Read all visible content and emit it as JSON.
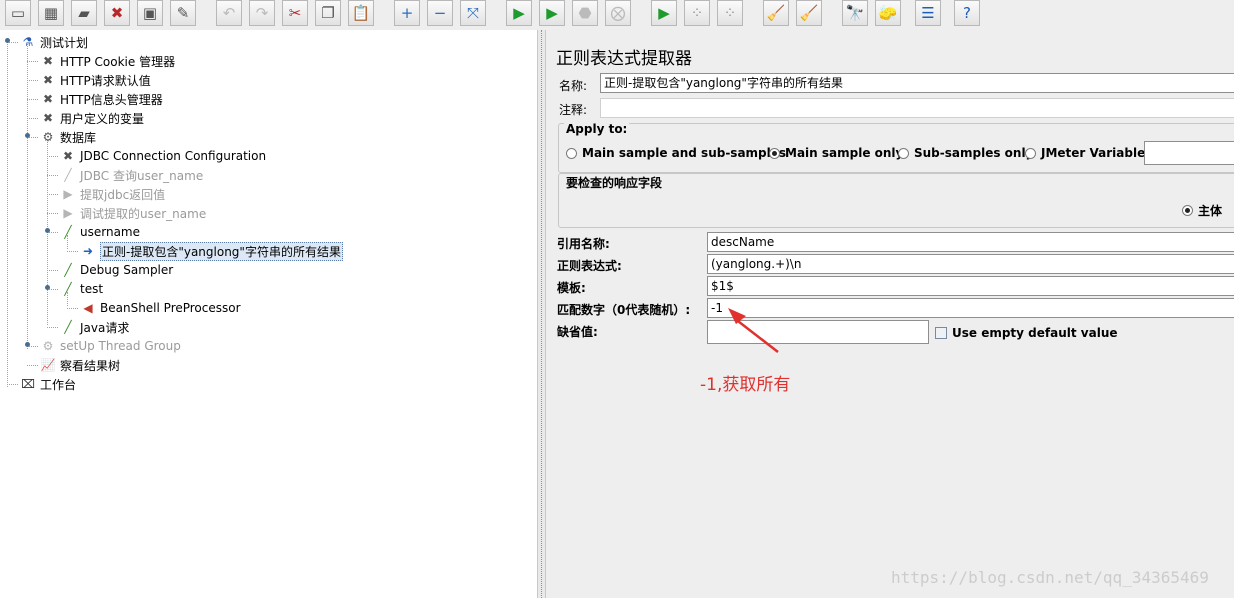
{
  "toolbar": {
    "buttons": [
      {
        "icon": "new-icon",
        "glyph": "▭"
      },
      {
        "icon": "templates-icon",
        "glyph": "▦"
      },
      {
        "icon": "open-icon",
        "glyph": "▰"
      },
      {
        "icon": "close-icon",
        "glyph": "✖"
      },
      {
        "icon": "save-icon",
        "glyph": "▣"
      },
      {
        "icon": "save-as-icon",
        "glyph": "✎"
      },
      {
        "icon": "undo-icon",
        "glyph": "↶"
      },
      {
        "icon": "redo-icon",
        "glyph": "↷"
      },
      {
        "icon": "cut-icon",
        "glyph": "✂"
      },
      {
        "icon": "copy-icon",
        "glyph": "❐"
      },
      {
        "icon": "paste-icon",
        "glyph": "📋"
      },
      {
        "icon": "expand-icon",
        "glyph": "+"
      },
      {
        "icon": "collapse-icon",
        "glyph": "−"
      },
      {
        "icon": "toggle-icon",
        "glyph": "⤧"
      },
      {
        "icon": "start-icon",
        "glyph": "▶"
      },
      {
        "icon": "start-no-pause-icon",
        "glyph": "▶"
      },
      {
        "icon": "stop-icon",
        "glyph": "⬣"
      },
      {
        "icon": "shutdown-icon",
        "glyph": "⨂"
      },
      {
        "icon": "remote-start-icon",
        "glyph": "▶"
      },
      {
        "icon": "remote-stop-icon",
        "glyph": "⁘"
      },
      {
        "icon": "remote-shutdown-icon",
        "glyph": "⁘"
      },
      {
        "icon": "clear-icon",
        "glyph": "🧹"
      },
      {
        "icon": "clear-all-icon",
        "glyph": "🧹"
      },
      {
        "icon": "search-icon",
        "glyph": "🔭"
      },
      {
        "icon": "reset-search-icon",
        "glyph": "🧽"
      },
      {
        "icon": "function-helper-icon",
        "glyph": "☰"
      },
      {
        "icon": "help-icon",
        "glyph": "?"
      }
    ]
  },
  "tree": {
    "nodes": [
      {
        "label": "测试计划",
        "icon": "test-plan-icon",
        "glyph": "⚗",
        "disabled": false,
        "selected": false
      },
      {
        "label": "HTTP Cookie 管理器",
        "icon": "config-tool-icon",
        "glyph": "✖",
        "disabled": false,
        "selected": false
      },
      {
        "label": "HTTP请求默认值",
        "icon": "config-tool-icon",
        "glyph": "✖",
        "disabled": false,
        "selected": false
      },
      {
        "label": "HTTP信息头管理器",
        "icon": "config-tool-icon",
        "glyph": "✖",
        "disabled": false,
        "selected": false
      },
      {
        "label": "用户定义的变量",
        "icon": "config-tool-icon",
        "glyph": "✖",
        "disabled": false,
        "selected": false
      },
      {
        "label": "数据库",
        "icon": "thread-group-icon",
        "glyph": "⚙",
        "disabled": false,
        "selected": false
      },
      {
        "label": "JDBC Connection Configuration",
        "icon": "config-tool-icon",
        "glyph": "✖",
        "disabled": false,
        "selected": false
      },
      {
        "label": "JDBC 查询user_name",
        "icon": "sampler-icon",
        "glyph": "╱",
        "disabled": true,
        "selected": false
      },
      {
        "label": "提取jdbc返回值",
        "icon": "post-processor-icon",
        "glyph": "▶",
        "disabled": true,
        "selected": false
      },
      {
        "label": "调试提取的user_name",
        "icon": "post-processor-icon",
        "glyph": "▶",
        "disabled": true,
        "selected": false
      },
      {
        "label": "username",
        "icon": "sampler-icon",
        "glyph": "╱",
        "disabled": false,
        "selected": false
      },
      {
        "label": "正则-提取包含\"yanglong\"字符串的所有结果",
        "icon": "post-processor-icon",
        "glyph": "➜",
        "disabled": false,
        "selected": true
      },
      {
        "label": "Debug Sampler",
        "icon": "sampler-icon",
        "glyph": "╱",
        "disabled": false,
        "selected": false
      },
      {
        "label": "test",
        "icon": "sampler-icon",
        "glyph": "╱",
        "disabled": false,
        "selected": false
      },
      {
        "label": "BeanShell PreProcessor",
        "icon": "pre-processor-icon",
        "glyph": "◀",
        "disabled": false,
        "selected": false
      },
      {
        "label": "Java请求",
        "icon": "sampler-icon",
        "glyph": "╱",
        "disabled": false,
        "selected": false
      },
      {
        "label": "setUp Thread Group",
        "icon": "thread-group-icon",
        "glyph": "⚙",
        "disabled": true,
        "selected": false
      },
      {
        "label": "察看结果树",
        "icon": "listener-icon",
        "glyph": "📈",
        "disabled": false,
        "selected": false
      },
      {
        "label": "工作台",
        "icon": "workbench-icon",
        "glyph": "⌧",
        "disabled": false,
        "selected": false
      }
    ]
  },
  "panel": {
    "title": "正则表达式提取器",
    "name_label": "名称:",
    "name_value": "正则-提取包含\"yanglong\"字符串的所有结果",
    "comment_label": "注释:",
    "comment_value": "",
    "apply_to": {
      "legend": "Apply to:",
      "options": [
        {
          "label": "Main sample and sub-samples",
          "selected": false
        },
        {
          "label": "Main sample only",
          "selected": true
        },
        {
          "label": "Sub-samples only",
          "selected": false
        },
        {
          "label": "JMeter Variable",
          "selected": false
        }
      ],
      "variable_value": ""
    },
    "response_field": {
      "legend": "要检查的响应字段",
      "option_label": "主体",
      "selected": true
    },
    "ref_name_label": "引用名称:",
    "ref_name_value": "descName",
    "regex_label": "正则表达式:",
    "regex_value": "(yanglong.+)\\n",
    "template_label": "模板:",
    "template_value": "$1$",
    "match_no_label": "匹配数字（0代表随机）:",
    "match_no_value": "-1",
    "default_label": "缺省值:",
    "default_value": "",
    "use_empty_label": "Use empty default value",
    "use_empty_checked": false
  },
  "annotation": {
    "text": "-1,获取所有",
    "color": "#e0312f"
  },
  "watermark": {
    "text": "https://blog.csdn.net/qq_34365469"
  }
}
